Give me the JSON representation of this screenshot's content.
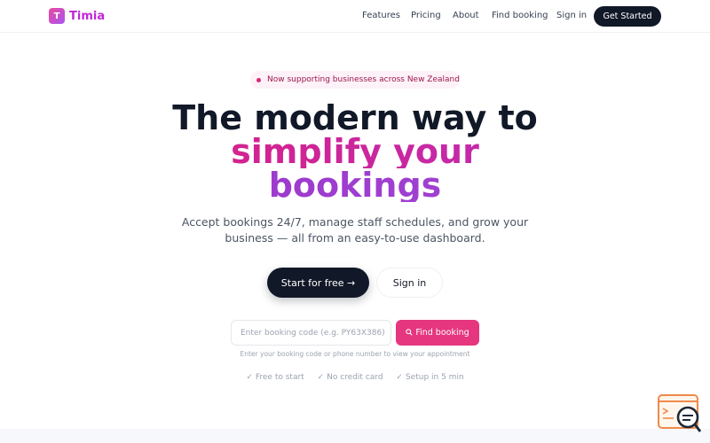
{
  "brand": {
    "logo_letter": "T",
    "name": "Timia"
  },
  "nav": {
    "links": [
      "Features",
      "Pricing",
      "About",
      "Find booking",
      "Sign in"
    ],
    "cta": "Get Started"
  },
  "hero": {
    "badge": "Now supporting businesses across New Zealand",
    "title_line1": "The modern way to",
    "title_line2": "simplify your",
    "title_line3": "bookings",
    "subtitle_line1": "Accept bookings 24/7, manage staff schedules, and grow your",
    "subtitle_line2": "business — all from an easy-to-use dashboard.",
    "primary_button": "Start for free →",
    "secondary_button": "Sign in"
  },
  "booking_lookup": {
    "input_value": "",
    "input_placeholder": "Enter booking code (e.g. PY63X386)",
    "button_icon": "search-icon",
    "button_label": "Find booking",
    "helper": "Enter your booking code or phone number to view your appointment"
  },
  "perks": [
    "Free to start",
    "No credit card",
    "Setup in 5 min"
  ],
  "colors": {
    "accent_pink": "#e5367f",
    "brand_purple": "#a855f7",
    "dark": "#111827"
  }
}
